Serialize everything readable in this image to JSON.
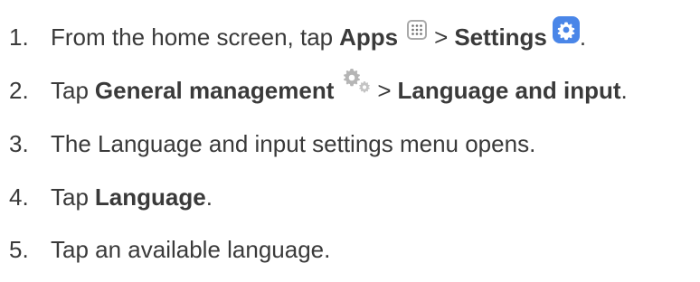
{
  "steps": [
    {
      "number": "1.",
      "text_before": "From the home screen, tap",
      "bold_1": "Apps",
      "separator": ">",
      "bold_2": "Settings",
      "end": "."
    },
    {
      "number": "2.",
      "text_before": "Tap",
      "bold_1": "General management",
      "separator": ">",
      "bold_2": "Language and input",
      "end": "."
    },
    {
      "number": "3.",
      "text": "The Language and input settings menu opens."
    },
    {
      "number": "4.",
      "text_before": "Tap",
      "bold_1": "Language",
      "end": "."
    },
    {
      "number": "5.",
      "text": "Tap an available language."
    }
  ],
  "icons": {
    "apps": "apps-icon",
    "settings": "settings-icon",
    "general_management": "gears-icon"
  },
  "colors": {
    "text": "#3a3a3a",
    "settings_icon_bg": "#4a86e8",
    "icon_gray": "#a9a9a9"
  }
}
